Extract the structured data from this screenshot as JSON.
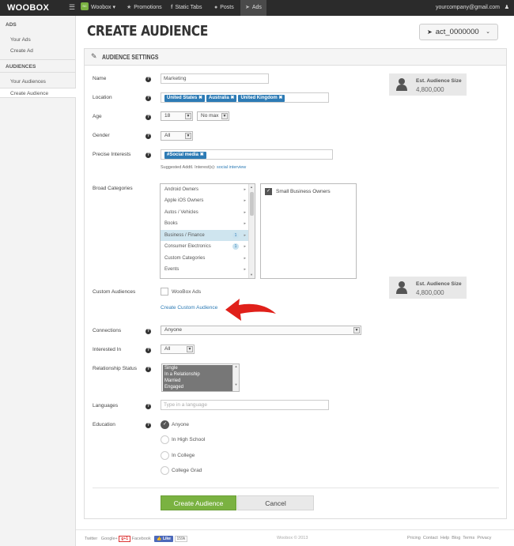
{
  "topbar": {
    "logo": "WOOBOX",
    "app_badge": "SC",
    "app_switcher": "Woobox ▾",
    "nav": [
      {
        "icon": "star-icon",
        "label": "Promotions"
      },
      {
        "icon": "facebook-icon",
        "label": "Static Tabs"
      },
      {
        "icon": "comment-icon",
        "label": "Posts"
      },
      {
        "icon": "megaphone-icon",
        "label": "Ads"
      }
    ],
    "email": "yourcompany@gmail.com"
  },
  "sidebar": {
    "sections": [
      {
        "heading": "ADS",
        "items": [
          "Your Ads",
          "Create Ad"
        ]
      },
      {
        "heading": "AUDIENCES",
        "items": [
          "Your Audiences",
          "Create Audience"
        ]
      }
    ],
    "active": "Create Audience"
  },
  "header": {
    "title": "Create Audience",
    "account": "act_0000000"
  },
  "panel": {
    "title": "Audience Settings"
  },
  "form": {
    "name": {
      "label": "Name",
      "value": "Marketing"
    },
    "location": {
      "label": "Location",
      "tags": [
        "United States",
        "Australia",
        "United Kingdom"
      ]
    },
    "age": {
      "label": "Age",
      "min": "18",
      "max": "No max"
    },
    "gender": {
      "label": "Gender",
      "value": "All"
    },
    "precise_interests": {
      "label": "Precise Interests",
      "tags": [
        "#Social media"
      ],
      "suggested_prefix": "Suggested Addtl. Interest(s):",
      "suggested_link": "social interview"
    },
    "broad_categories": {
      "label": "Broad Categories",
      "items": [
        {
          "label": "Android Owners",
          "count": ""
        },
        {
          "label": "Apple iOS Owners",
          "count": ""
        },
        {
          "label": "Autos / Vehicles",
          "count": ""
        },
        {
          "label": "Books",
          "count": ""
        },
        {
          "label": "Business / Finance",
          "count": "1"
        },
        {
          "label": "Consumer Electronics",
          "count": "1"
        },
        {
          "label": "Custom Categories",
          "count": ""
        },
        {
          "label": "Events",
          "count": ""
        }
      ],
      "selected_index": 4,
      "chosen": [
        "Small Business Owners"
      ]
    },
    "custom_audiences": {
      "label": "Custom Audiences",
      "option": "WooBox Ads",
      "create_link": "Create Custom Audience"
    },
    "connections": {
      "label": "Connections",
      "value": "Anyone"
    },
    "interested_in": {
      "label": "Interested In",
      "value": "All"
    },
    "relationship": {
      "label": "Relationship Status",
      "options": [
        "Single",
        "In a Relationship",
        "Married",
        "Engaged"
      ]
    },
    "languages": {
      "label": "Languages",
      "placeholder": "Type in a language"
    },
    "education": {
      "label": "Education",
      "options": [
        "Anyone",
        "In High School",
        "In College",
        "College Grad"
      ],
      "selected": "Anyone"
    }
  },
  "audience_size": {
    "label": "Est. Audience Size",
    "value": "4,800,000"
  },
  "buttons": {
    "create": "Create Audience",
    "cancel": "Cancel"
  },
  "footer": {
    "left": {
      "twitter": "Twitter",
      "google": "Google+",
      "gplus": "g+1",
      "facebook": "Facebook",
      "like": "Like",
      "like_count": "159k"
    },
    "copyright": "Woobox © 2013",
    "links": [
      "Pricing",
      "Contact",
      "Help",
      "Blog",
      "Terms",
      "Privacy"
    ]
  },
  "colors": {
    "accent": "#2d7bb5",
    "primary_button": "#7ab241",
    "topbar": "#2b2b2b",
    "arrow": "#e0201a"
  }
}
